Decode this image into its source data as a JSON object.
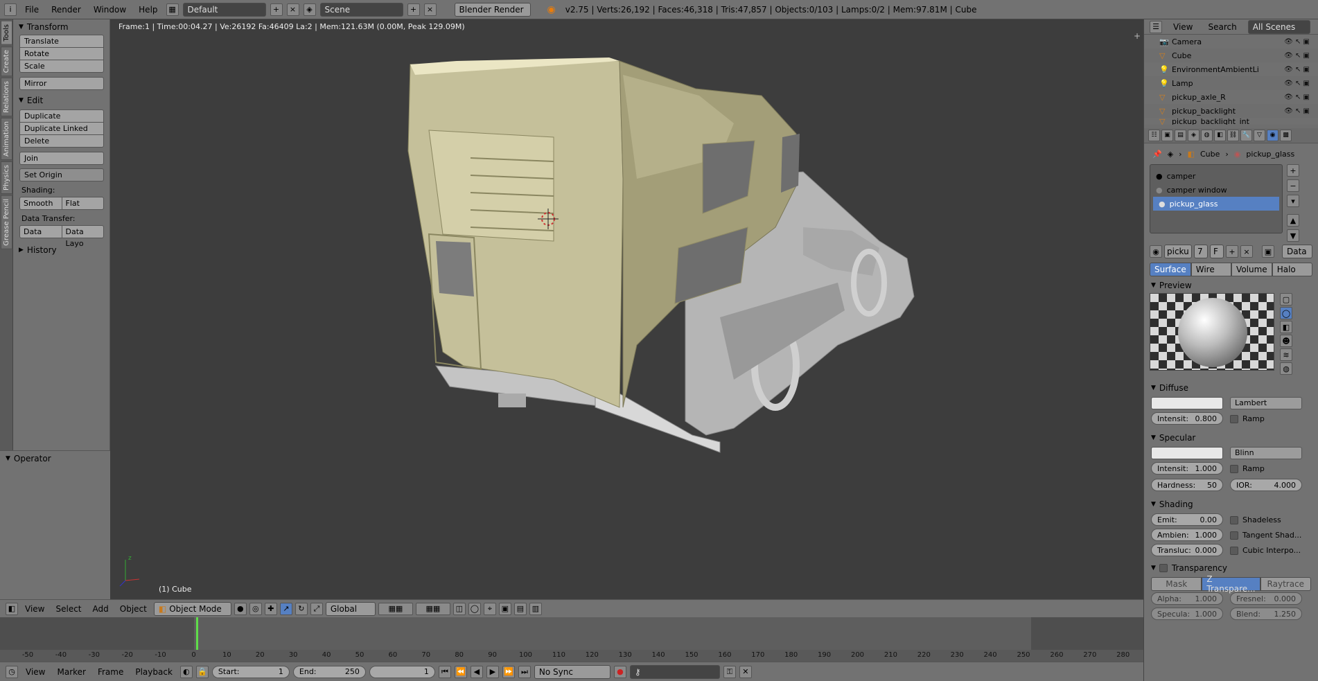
{
  "topbar": {
    "menus": [
      "File",
      "Render",
      "Window",
      "Help"
    ],
    "layout": "Default",
    "scene": "Scene",
    "engine": "Blender Render",
    "stats": "v2.75 | Verts:26,192 | Faces:46,318 | Tris:47,857 | Objects:0/103 | Lamps:0/2 | Mem:97.81M | Cube"
  },
  "lefttabs": [
    "Tools",
    "Create",
    "Relations",
    "Animation",
    "Physics",
    "Grease Pencil"
  ],
  "tools": {
    "transform_header": "Transform",
    "translate": "Translate",
    "rotate": "Rotate",
    "scale": "Scale",
    "mirror": "Mirror",
    "edit_header": "Edit",
    "duplicate": "Duplicate",
    "duplicate_linked": "Duplicate Linked",
    "delete": "Delete",
    "join": "Join",
    "set_origin": "Set Origin",
    "shading_label": "Shading:",
    "smooth": "Smooth",
    "flat": "Flat",
    "data_transfer_label": "Data Transfer:",
    "data": "Data",
    "data_layout": "Data Layo",
    "history_header": "History",
    "operator_header": "Operator"
  },
  "viewport": {
    "info": "Frame:1 | Time:00:04.27 | Ve:26192 Fa:46409 La:2 | Mem:121.63M (0.00M, Peak 129.09M)",
    "object_name": "(1) Cube"
  },
  "vp_header": {
    "menus": [
      "View",
      "Select",
      "Add",
      "Object"
    ],
    "mode": "Object Mode",
    "orientation": "Global"
  },
  "timeline": {
    "ticks": [
      "-50",
      "-40",
      "-30",
      "-20",
      "-10",
      "0",
      "10",
      "20",
      "30",
      "40",
      "50",
      "60",
      "70",
      "80",
      "90",
      "100",
      "110",
      "120",
      "130",
      "140",
      "150",
      "160",
      "170",
      "180",
      "190",
      "200",
      "210",
      "220",
      "230",
      "240",
      "250",
      "260",
      "270",
      "280"
    ],
    "current_frame": 1
  },
  "tl_header": {
    "menus": [
      "View",
      "Marker",
      "Frame",
      "Playback"
    ],
    "start_label": "Start:",
    "start": "1",
    "end_label": "End:",
    "end": "250",
    "frame": "1",
    "sync": "No Sync"
  },
  "outliner": {
    "menus": [
      "View",
      "Search"
    ],
    "scenes": "All Scenes",
    "items": [
      "Camera",
      "Cube",
      "EnvironmentAmbientLi",
      "Lamp",
      "pickup_axle_R",
      "pickup_backlight",
      "pickup_backlight_int"
    ]
  },
  "properties": {
    "breadcrumb_obj": "Cube",
    "breadcrumb_mat": "pickup_glass",
    "materials": [
      "camper",
      "camper window",
      "pickup_glass"
    ],
    "selected_material": "pickup_glass",
    "mat_field": "picku",
    "users": "7",
    "fake": "F",
    "data_sel": "Data",
    "type_tabs": [
      "Surface",
      "Wire",
      "Volume",
      "Halo"
    ],
    "preview_header": "Preview",
    "diffuse_header": "Diffuse",
    "diffuse_shader": "Lambert",
    "diffuse_intensity_label": "Intensit:",
    "diffuse_intensity": "0.800",
    "ramp": "Ramp",
    "specular_header": "Specular",
    "specular_shader": "Blinn",
    "specular_intensity_label": "Intensit:",
    "specular_intensity": "1.000",
    "hardness_label": "Hardness:",
    "hardness": "50",
    "ior_label": "IOR:",
    "ior": "4.000",
    "shading_header": "Shading",
    "emit_label": "Emit:",
    "emit": "0.00",
    "shadeless": "Shadeless",
    "ambient_label": "Ambien:",
    "ambient": "1.000",
    "tangent": "Tangent Shad...",
    "transluc_label": "Transluc:",
    "transluc": "0.000",
    "cubic": "Cubic Interpo...",
    "transparency_header": "Transparency",
    "trans_modes": [
      "Mask",
      "Z Transpare...",
      "Raytrace"
    ],
    "alpha_label": "Alpha:",
    "alpha": "1.000",
    "fresnel_label": "Fresnel:",
    "fresnel": "0.000",
    "specula_label": "Specula:",
    "specula": "1.000",
    "blend_label": "Blend:",
    "blend": "1.250"
  }
}
